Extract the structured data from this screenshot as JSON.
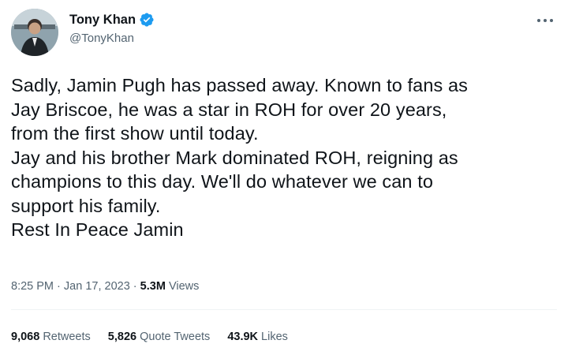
{
  "author": {
    "display_name": "Tony Khan",
    "handle": "@TonyKhan",
    "avatar_icon": "profile-photo",
    "verified_icon": "verified-badge-icon",
    "verified_color": "#1d9bf0"
  },
  "more_icon": "more-options-icon",
  "tweet": {
    "lines": [
      "Sadly, Jamin Pugh has passed away. Known to fans as",
      "Jay Briscoe, he was a star in ROH for over 20 years,",
      "from the first show until today.",
      "Jay and his brother Mark dominated ROH, reigning as",
      "champions to this day. We'll do whatever we can to",
      "support his family.",
      "Rest In Peace Jamin"
    ]
  },
  "meta": {
    "time": "8:25 PM",
    "separator": "·",
    "date": "Jan 17, 2023",
    "views_count": "5.3M",
    "views_label": "Views"
  },
  "stats": {
    "retweets_count": "9,068",
    "retweets_label": "Retweets",
    "quotes_count": "5,826",
    "quotes_label": "Quote Tweets",
    "likes_count": "43.9K",
    "likes_label": "Likes"
  },
  "colors": {
    "text_primary": "#0f1419",
    "text_secondary": "#536471",
    "divider": "#eff3f4"
  }
}
